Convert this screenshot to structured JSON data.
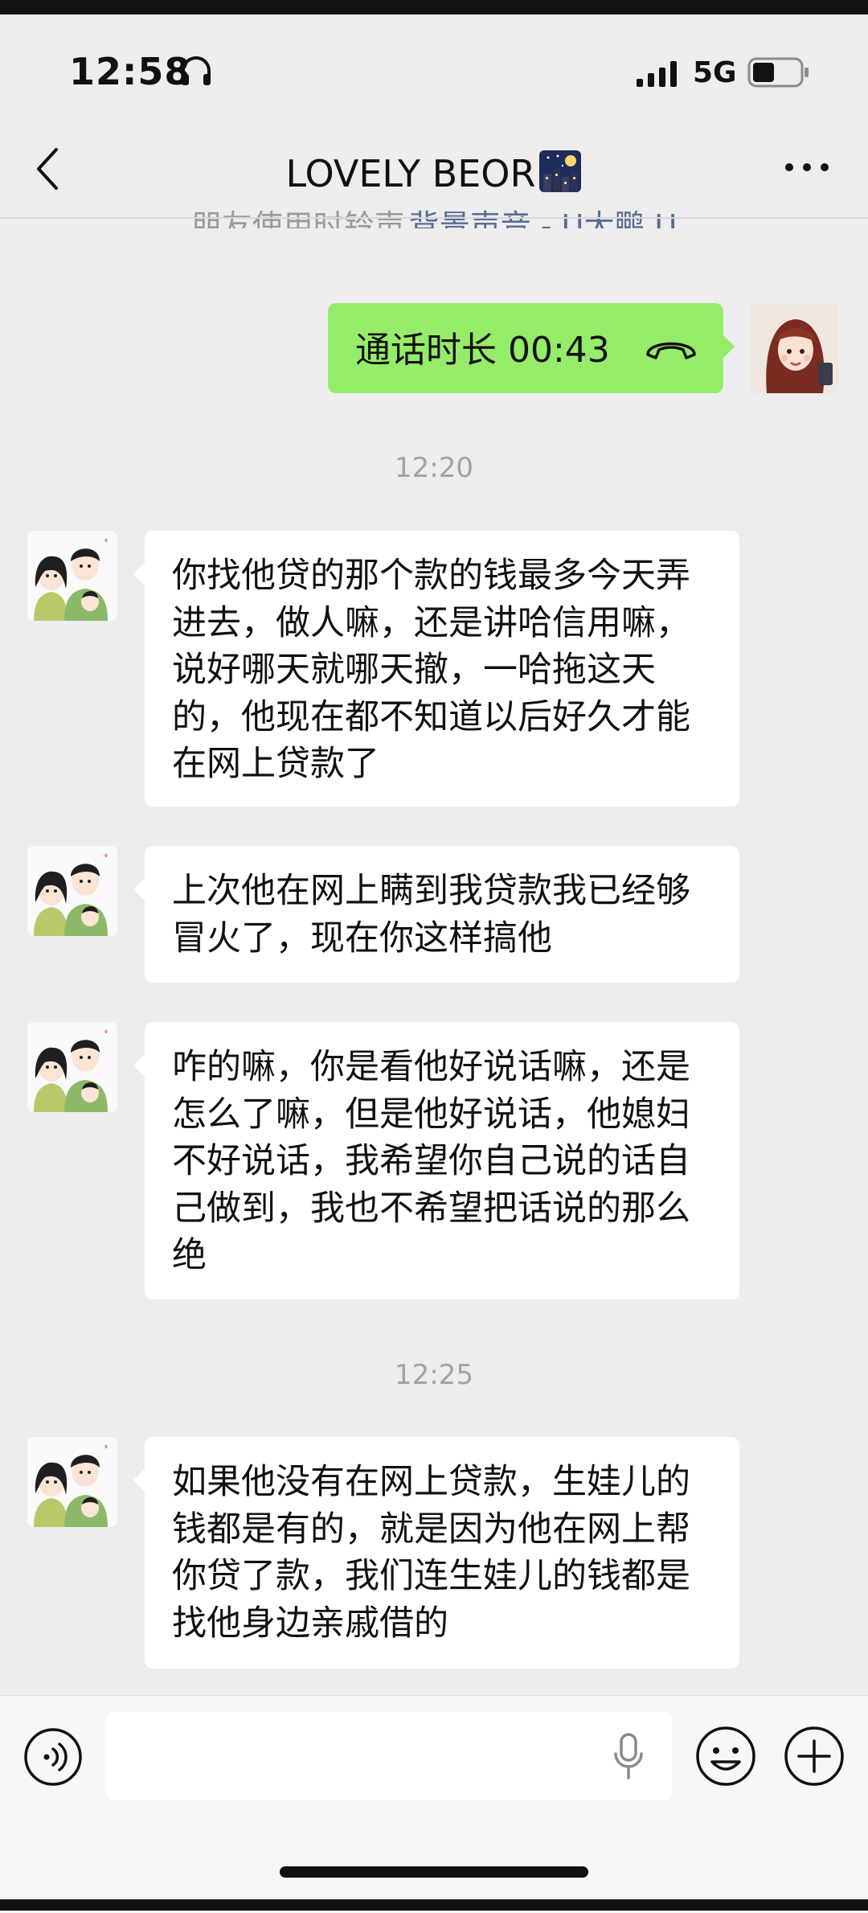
{
  "status_bar": {
    "time": "12:58",
    "network": "5G"
  },
  "nav": {
    "title": "LOVELY BEOR"
  },
  "cut_note": {
    "part1": "朋友使用时铃声",
    "part2": "背景声音 - U大鹏 U"
  },
  "call": {
    "text": "通话时长 00:43"
  },
  "messages": [
    {
      "text": "你找他贷的那个款的钱最多今天弄进去，做人嘛，还是讲哈信用嘛，说好哪天就哪天撤，一哈拖这天的，他现在都不知道以后好久才能在网上贷款了"
    },
    {
      "text": "上次他在网上瞒到我贷款我已经够冒火了，现在你这样搞他"
    },
    {
      "text": "咋的嘛，你是看他好说话嘛，还是怎么了嘛，但是他好说话，他媳妇不好说话，我希望你自己说的话自己做到，我也不希望把话说的那么绝"
    },
    {
      "text": "如果他没有在网上贷款，生娃儿的钱都是有的，就是因为他在网上帮你贷了款，我们连生娃儿的钱都是找他身边亲戚借的"
    }
  ],
  "timestamps": [
    "12:20",
    "12:25"
  ],
  "input": {
    "value": ""
  },
  "colors": {
    "self_bubble": "#95ec69",
    "other_bubble": "#ffffff",
    "background": "#ededed"
  }
}
